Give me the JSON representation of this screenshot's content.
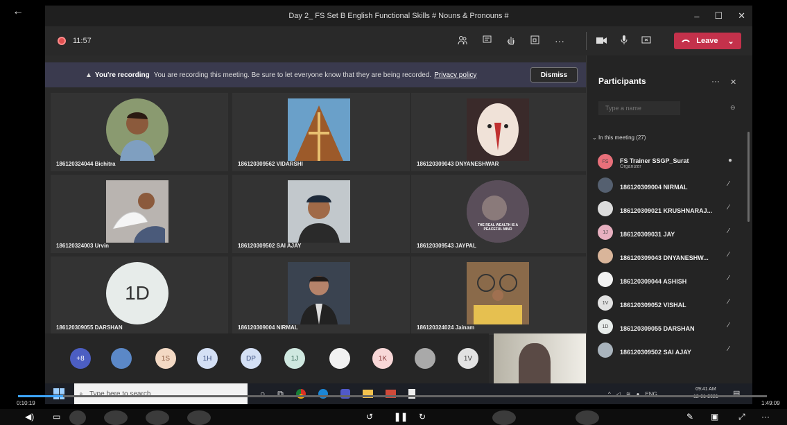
{
  "window": {
    "title": "Day 2_ FS Set B English Functional Skills # Nouns & Pronouns #",
    "minimize": "–",
    "maximize": "☐",
    "close": "✕"
  },
  "toolbar": {
    "timer": "11:57",
    "leave_label": "Leave"
  },
  "banner": {
    "bold": "You're recording",
    "message": "You are recording this meeting. Be sure to let everyone know that they are being recorded.",
    "link": "Privacy policy",
    "dismiss": "Dismiss"
  },
  "tiles": [
    {
      "name": "186120324044 Bichitra",
      "color": "#8a9a70"
    },
    {
      "name": "186120309562 VIDARSHI",
      "color": "#b8703a"
    },
    {
      "name": "186120309043 DNYANESHWAR",
      "color": "#d9b59a"
    },
    {
      "name": "186120324003 Urvin",
      "color": "#c7c7c7"
    },
    {
      "name": "186120309502 SAI AJAY",
      "color": "#a9b4bd"
    },
    {
      "name": "186120309543 JAYPAL",
      "color": "#6a5e6a",
      "caption": "THE REAL WEALTH IS A PEACEFUL MIND"
    },
    {
      "name": "186120309055 DARSHAN",
      "initials": "1D"
    },
    {
      "name": "186120309004 NIRMAL",
      "color": "#556070"
    },
    {
      "name": "186120324024 Jainam",
      "color": "#b28a55"
    }
  ],
  "strip": [
    {
      "label": "+8",
      "bg": "#4c5ec2",
      "fg": "#fff"
    },
    {
      "label": "",
      "bg": "#5b88c7",
      "fg": "#fff"
    },
    {
      "label": "1S",
      "bg": "#f3d9c4",
      "fg": "#8a5a40"
    },
    {
      "label": "1H",
      "bg": "#d4e0f5",
      "fg": "#3a4f80"
    },
    {
      "label": "DP",
      "bg": "#d4e0f5",
      "fg": "#3a4f80"
    },
    {
      "label": "1J",
      "bg": "#cfe8e0",
      "fg": "#3a6a5a"
    },
    {
      "label": "",
      "bg": "#f2f2f2",
      "fg": "#333"
    },
    {
      "label": "1K",
      "bg": "#f8d7d7",
      "fg": "#8a3a3a"
    },
    {
      "label": "",
      "bg": "#a9a9a9",
      "fg": "#fff"
    },
    {
      "label": "1V",
      "bg": "#e2e2e2",
      "fg": "#444"
    }
  ],
  "panel": {
    "title": "Participants",
    "more": "···",
    "close": "✕",
    "search_placeholder": "Type a name",
    "section": "In this meeting (27)",
    "participants": [
      {
        "name": "FS Trainer SSGP_Surat",
        "sub": "Organizer",
        "initials": "FS",
        "bg": "#e8707a"
      },
      {
        "name": "186120309004 NIRMAL",
        "sub": "",
        "initials": "",
        "bg": "#556070"
      },
      {
        "name": "186120309021 KRUSHNARAJ...",
        "sub": "",
        "initials": "",
        "bg": "#dcdcdc"
      },
      {
        "name": "186120309031 JAY",
        "sub": "",
        "initials": "1J",
        "bg": "#e8b0c0"
      },
      {
        "name": "186120309043 DNYANESHW...",
        "sub": "",
        "initials": "",
        "bg": "#d9b59a"
      },
      {
        "name": "186120309044 ASHISH",
        "sub": "",
        "initials": "",
        "bg": "#f2f2f2"
      },
      {
        "name": "186120309052 VISHAL",
        "sub": "",
        "initials": "1V",
        "bg": "#e2e2e2"
      },
      {
        "name": "186120309055 DARSHAN",
        "sub": "",
        "initials": "1D",
        "bg": "#e7ecea"
      },
      {
        "name": "186120309502 SAI AJAY",
        "sub": "",
        "initials": "",
        "bg": "#a9b4bd"
      }
    ]
  },
  "taskbar": {
    "search_placeholder": "Type here to search",
    "tray_lang": "ENG",
    "time": "09:41 AM",
    "date": "12-01-2021"
  },
  "player": {
    "current": "0:10:19",
    "total": "1:49:09",
    "progress_percent": 6
  }
}
